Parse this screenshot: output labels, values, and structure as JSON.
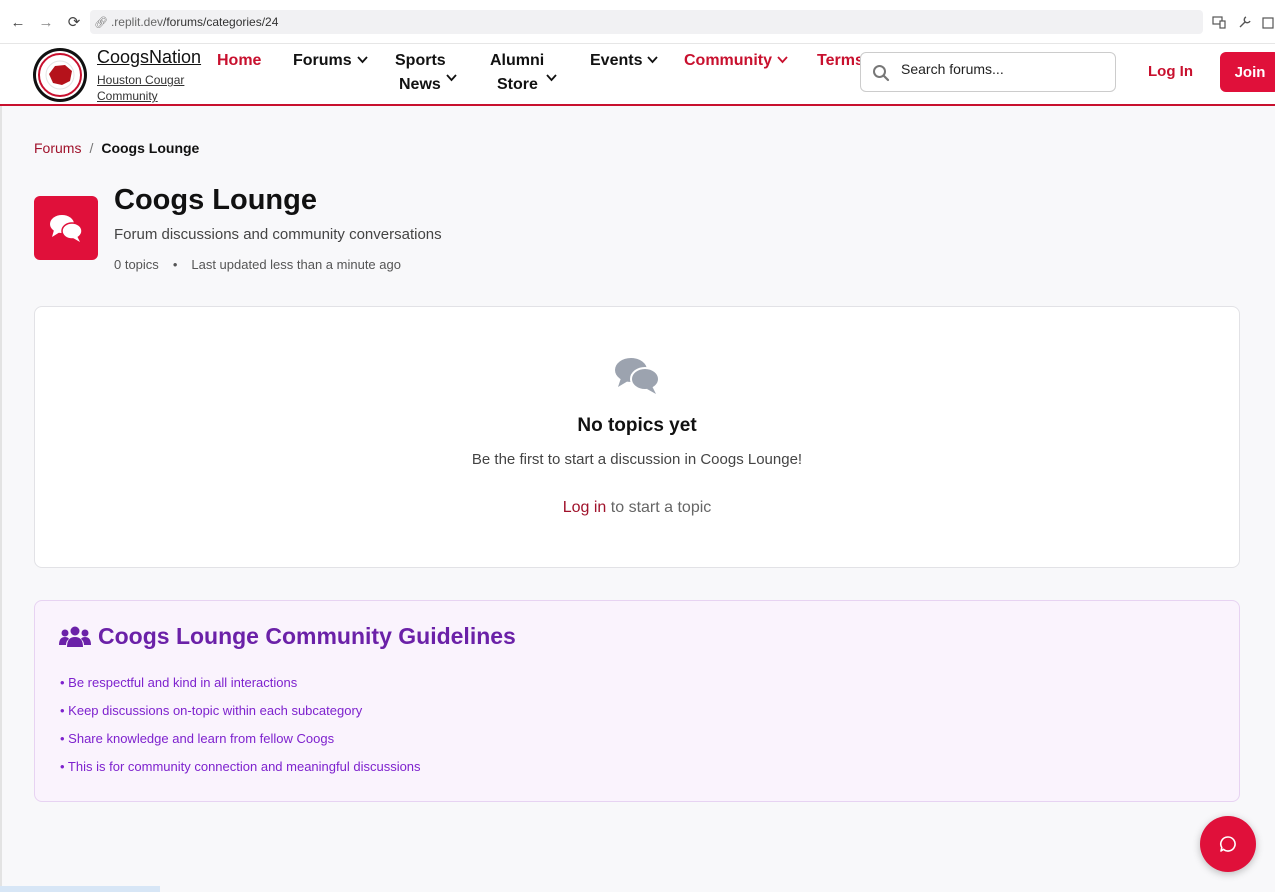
{
  "browser": {
    "url_prefix": ".replit.dev",
    "url_path": "/forums/categories/24"
  },
  "header": {
    "brand_name": "CoogsNation",
    "brand_sub": "Houston Cougar Community",
    "nav": [
      {
        "label": "Home"
      },
      {
        "label": "Forums"
      },
      {
        "label_line1": "Sports",
        "label_line2": "News"
      },
      {
        "label_line1": "Alumni",
        "label_line2": "Store"
      },
      {
        "label": "Events"
      },
      {
        "label": "Community"
      },
      {
        "label": "Terms"
      }
    ],
    "search_placeholder": "Search forums...",
    "login_label": "Log In",
    "join_label": "Join"
  },
  "breadcrumb": {
    "parent": "Forums",
    "separator": "/",
    "current": "Coogs Lounge"
  },
  "category": {
    "title": "Coogs Lounge",
    "description": "Forum discussions and community conversations",
    "topics_count": "0 topics",
    "meta_dot": "•",
    "updated": "Last updated less than a minute ago"
  },
  "empty_state": {
    "title": "No topics yet",
    "subtitle": "Be the first to start a discussion in Coogs Lounge!",
    "cta_link": "Log in",
    "cta_rest": " to start a topic"
  },
  "guidelines": {
    "title": "Coogs Lounge Community Guidelines",
    "items": [
      "• Be respectful and kind in all interactions",
      "• Keep discussions on-topic within each subcategory",
      "• Share knowledge and learn from fellow Coogs",
      "• This is for community connection and meaningful discussions"
    ]
  },
  "colors": {
    "brand_red": "#c8102e",
    "button_red": "#e0103a",
    "guideline_purple": "#6b21a8",
    "guideline_bg": "#faf3fd"
  }
}
